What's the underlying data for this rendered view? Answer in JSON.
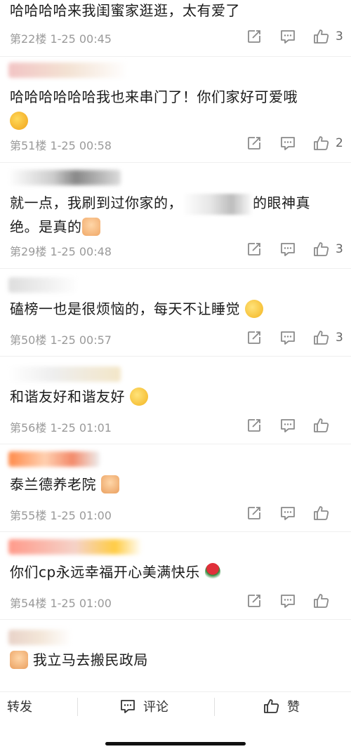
{
  "comments": [
    {
      "text": "哈哈哈哈来我闺蜜家逛逛，太有爱了",
      "floor": "第22楼",
      "time": "1-25 00:45",
      "likes": "3"
    },
    {
      "text": "哈哈哈哈哈哈我也来串门了！你们家好可爱哦",
      "floor": "第51楼",
      "time": "1-25 00:58",
      "likes": "2"
    },
    {
      "text_a": "就一点，我刷到过你家的，",
      "text_b": "的眼神真",
      "text_c": "绝。是真的",
      "floor": "第29楼",
      "time": "1-25 00:48",
      "likes": "3"
    },
    {
      "text": "磕榜一也是很烦恼的，每天不让睡觉",
      "floor": "第50楼",
      "time": "1-25 00:57",
      "likes": "3"
    },
    {
      "text": "和谐友好和谐友好",
      "floor": "第56楼",
      "time": "1-25 01:01",
      "likes": ""
    },
    {
      "text": "泰兰德养老院",
      "floor": "第55楼",
      "time": "1-25 01:00",
      "likes": ""
    },
    {
      "text": "你们cp永远幸福开心美满快乐",
      "floor": "第54楼",
      "time": "1-25 01:00",
      "likes": ""
    },
    {
      "text": "我立马去搬民政局"
    }
  ],
  "bottom_bar": {
    "repost": "转发",
    "comment": "评论",
    "like": "赞"
  },
  "icons": [
    "repost-icon",
    "reply-icon",
    "like-icon",
    "comment-icon",
    "thumbs-up-icon"
  ],
  "colors": {
    "meta": "#9a9a9a",
    "icon": "#8a8a8a"
  }
}
